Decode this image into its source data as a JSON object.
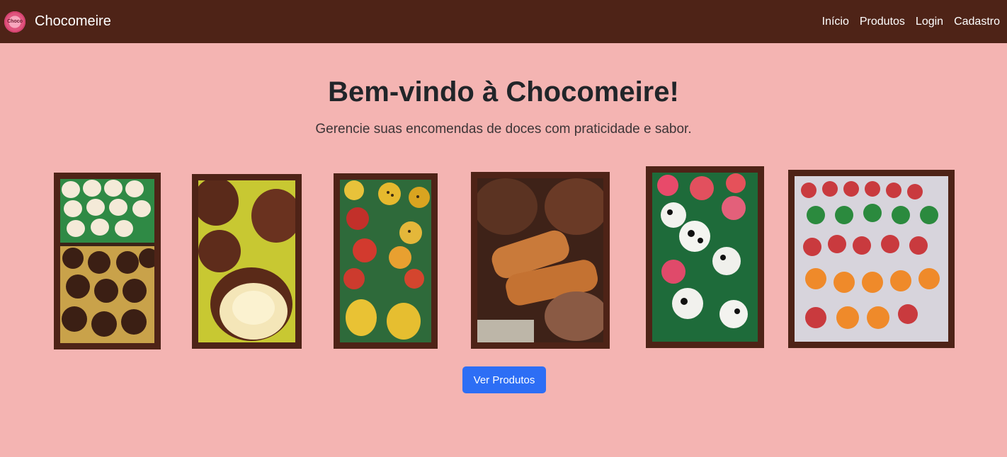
{
  "nav": {
    "brand": "Chocomeire",
    "links": [
      "Início",
      "Produtos",
      "Login",
      "Cadastro"
    ]
  },
  "hero": {
    "title": "Bem-vindo à Chocomeire!",
    "subtitle": "Gerencie suas encomendas de doces com praticidade e sabor."
  },
  "gallery": [
    {
      "icon": "chocolate-truffles-photo"
    },
    {
      "icon": "bonbon-photo"
    },
    {
      "icon": "fruit-marzipan-photo"
    },
    {
      "icon": "caramel-cookie-photo"
    },
    {
      "icon": "cow-pig-candies-photo"
    },
    {
      "icon": "watermelon-pumpkin-candies-photo"
    }
  ],
  "cta": {
    "label": "Ver Produtos"
  },
  "colors": {
    "navbar": "#4e2317",
    "background": "#f4b4b2",
    "button": "#2d6ef5"
  }
}
